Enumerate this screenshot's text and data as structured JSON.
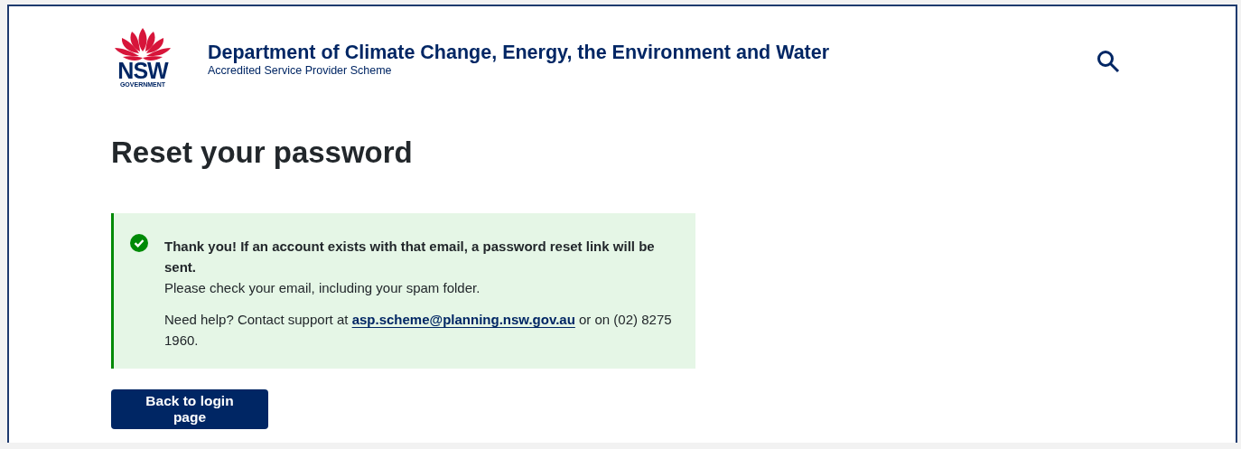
{
  "header": {
    "logo": {
      "wordmark": "NSW",
      "subtext": "GOVERNMENT"
    },
    "title": "Department of Climate Change, Energy, the Environment and Water",
    "subtitle": "Accredited Service Provider Scheme"
  },
  "page_title": "Reset your password",
  "notice": {
    "kind": "success",
    "heading": "Thank you! If an account exists with that email, a password reset link will be sent.",
    "message": "Please check your email, including your spam folder.",
    "help": {
      "before": "Need help? Contact support at ",
      "link": "asp.scheme@planning.nsw.gov.au",
      "after": " or on (02) 8275 1960."
    }
  },
  "button": "Back to login page"
}
